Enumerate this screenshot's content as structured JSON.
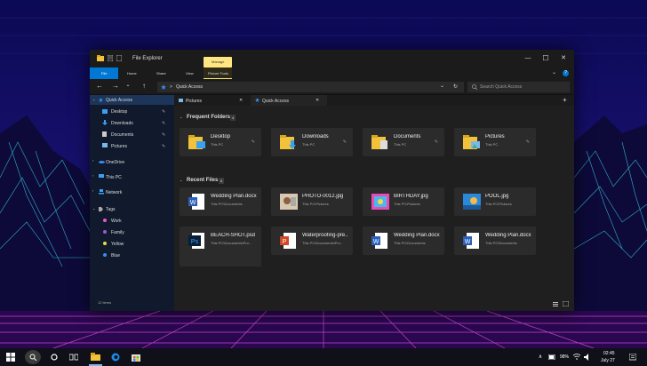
{
  "window": {
    "title": "File Explorer",
    "minimize": "—",
    "maximize": "☐",
    "close": "✕"
  },
  "ribbon": {
    "tabs": [
      "File",
      "Home",
      "Share",
      "View"
    ],
    "contextual_header": "Manage",
    "contextual_tab": "Picture Tools",
    "expand": "⌄",
    "help": "?"
  },
  "navbar": {
    "back": "←",
    "forward": "→",
    "recent": "⌄",
    "up": "↑",
    "path": "Quick Access",
    "sep": ">",
    "dropdown": "⌄",
    "refresh": "↻",
    "search_placeholder": "Search Quick Access"
  },
  "tabs": [
    {
      "label": "Pictures",
      "close": "✕"
    },
    {
      "label": "Quick Access",
      "close": "✕"
    }
  ],
  "new_tab": "+",
  "sidebar": {
    "quick_access": "Quick Access",
    "items": [
      "Desktop",
      "Downloads",
      "Documents",
      "Pictures"
    ],
    "onedrive": "OneDrive",
    "this_pc": "This PC",
    "network": "Network",
    "tags": "Tags",
    "tag_items": [
      {
        "label": "Work",
        "color": "#e05ad8"
      },
      {
        "label": "Family",
        "color": "#9b59e0"
      },
      {
        "label": "Yellow",
        "color": "#e8d84a"
      },
      {
        "label": "Blue",
        "color": "#3a8cf0"
      }
    ],
    "status": "12 items"
  },
  "frequent": {
    "title": "Frequent Folders",
    "count": "4",
    "items": [
      {
        "name": "Desktop",
        "sub": "This PC"
      },
      {
        "name": "Downloads",
        "sub": "This PC"
      },
      {
        "name": "Documents",
        "sub": "This PC"
      },
      {
        "name": "Pictures",
        "sub": "This PC"
      }
    ]
  },
  "recent": {
    "title": "Recent Files",
    "count": "8",
    "items": [
      {
        "name": "Wedding Plan.docx",
        "sub": "This PC\\Documents",
        "icon": "word-icon"
      },
      {
        "name": "PHOTO-0012.jpg",
        "sub": "This PC\\Pictures",
        "icon": "photo-icon"
      },
      {
        "name": "BIRTHDAY.jpg",
        "sub": "This PC\\Pictures",
        "icon": "photo-icon"
      },
      {
        "name": "POOL.jpg",
        "sub": "This PC\\Pictures",
        "icon": "photo-icon"
      },
      {
        "name": "BEACH-SHOT.psd",
        "sub": "This PC\\Documents\\Pro...",
        "icon": "photoshop-icon"
      },
      {
        "name": "Waterproofing-pre...",
        "sub": "This PC\\Documents\\Pro...",
        "icon": "powerpoint-icon"
      },
      {
        "name": "Wedding Plan.docx",
        "sub": "This PC\\Documents",
        "icon": "word-icon"
      },
      {
        "name": "Wedding Plan.docx",
        "sub": "This PC\\Documents",
        "icon": "word-icon"
      }
    ]
  },
  "taskbar": {
    "time": "02:45",
    "date": "July 27",
    "battery": "98%",
    "chevron": "∧"
  },
  "colors": {
    "accent": "#0078d4",
    "manage": "#ffe680",
    "sidebar_bg": "#101a2c"
  }
}
